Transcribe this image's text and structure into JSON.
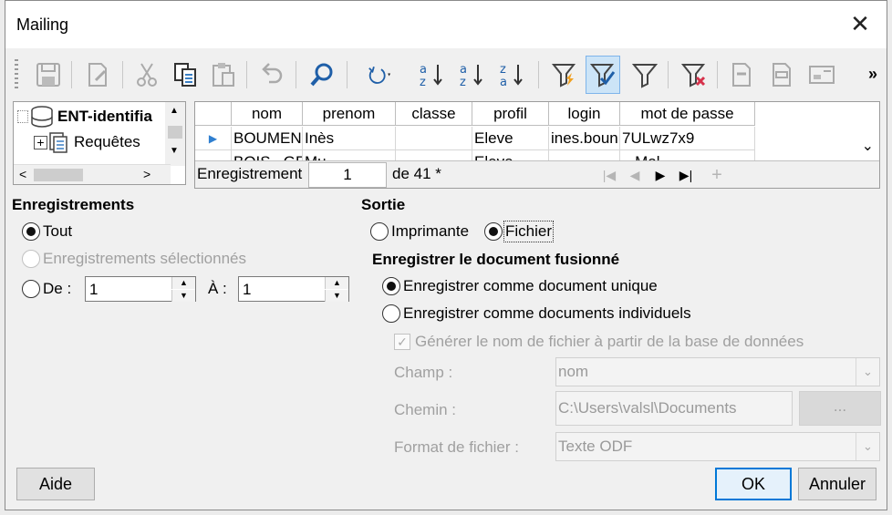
{
  "window": {
    "title": "Mailing",
    "close_glyph": "✕"
  },
  "toolbar": {
    "icons": [
      "save-icon",
      "edit-icon",
      "cut-icon",
      "copy-icon",
      "paste-icon",
      "undo-icon",
      "find-icon",
      "refresh-icon",
      "sort-ascending-icon",
      "sort-descending-icon",
      "sort-icon",
      "autofilter-icon",
      "apply-filter-icon",
      "standard-filter-icon",
      "reset-filter-icon",
      "data-to-text-icon",
      "data-to-fields-icon",
      "mail-merge-icon"
    ],
    "more_glyph": "»"
  },
  "tree": {
    "root": "ENT-identifia",
    "child": "Requêtes"
  },
  "grid": {
    "columns": [
      "nom",
      "prenom",
      "classe",
      "profil",
      "login",
      "mot de passe"
    ],
    "rows": [
      [
        "BOUMEN",
        "Inès",
        "",
        "Eleve",
        "ines.boun",
        "7ULwz7x9"
      ],
      [
        "BOIS...GE",
        "Mu...",
        "",
        "Eleve",
        "...",
        "...Mal..."
      ]
    ],
    "nav": {
      "label": "Enregistrement",
      "current": "1",
      "count": "de 41 *"
    }
  },
  "records": {
    "title": "Enregistrements",
    "all": "Tout",
    "selected": "Enregistrements sélectionnés",
    "from": "De :",
    "to": "À :",
    "from_value": "1",
    "to_value": "1"
  },
  "output": {
    "title": "Sortie",
    "printer": "Imprimante",
    "file": "Fichier",
    "save_title": "Enregistrer le document fusionné",
    "single": "Enregistrer comme document unique",
    "individual": "Enregistrer comme documents individuels",
    "generate": "Générer le nom de fichier à partir de la base de données",
    "field_label": "Champ :",
    "field_value": "nom",
    "path_label": "Chemin :",
    "path_value": "C:\\Users\\valsl\\Documents",
    "browse": "...",
    "format_label": "Format de fichier :",
    "format_value": "Texte ODF"
  },
  "buttons": {
    "help": "Aide",
    "ok": "OK",
    "cancel": "Annuler"
  }
}
